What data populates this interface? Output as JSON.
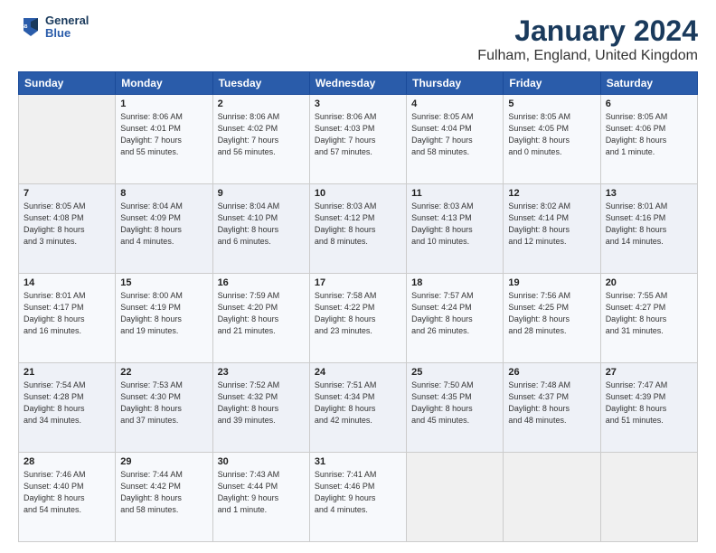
{
  "header": {
    "logo_text_1": "General",
    "logo_text_2": "Blue",
    "month": "January 2024",
    "location": "Fulham, England, United Kingdom"
  },
  "weekdays": [
    "Sunday",
    "Monday",
    "Tuesday",
    "Wednesday",
    "Thursday",
    "Friday",
    "Saturday"
  ],
  "weeks": [
    [
      {
        "day": "",
        "info": ""
      },
      {
        "day": "1",
        "info": "Sunrise: 8:06 AM\nSunset: 4:01 PM\nDaylight: 7 hours\nand 55 minutes."
      },
      {
        "day": "2",
        "info": "Sunrise: 8:06 AM\nSunset: 4:02 PM\nDaylight: 7 hours\nand 56 minutes."
      },
      {
        "day": "3",
        "info": "Sunrise: 8:06 AM\nSunset: 4:03 PM\nDaylight: 7 hours\nand 57 minutes."
      },
      {
        "day": "4",
        "info": "Sunrise: 8:05 AM\nSunset: 4:04 PM\nDaylight: 7 hours\nand 58 minutes."
      },
      {
        "day": "5",
        "info": "Sunrise: 8:05 AM\nSunset: 4:05 PM\nDaylight: 8 hours\nand 0 minutes."
      },
      {
        "day": "6",
        "info": "Sunrise: 8:05 AM\nSunset: 4:06 PM\nDaylight: 8 hours\nand 1 minute."
      }
    ],
    [
      {
        "day": "7",
        "info": "Sunrise: 8:05 AM\nSunset: 4:08 PM\nDaylight: 8 hours\nand 3 minutes."
      },
      {
        "day": "8",
        "info": "Sunrise: 8:04 AM\nSunset: 4:09 PM\nDaylight: 8 hours\nand 4 minutes."
      },
      {
        "day": "9",
        "info": "Sunrise: 8:04 AM\nSunset: 4:10 PM\nDaylight: 8 hours\nand 6 minutes."
      },
      {
        "day": "10",
        "info": "Sunrise: 8:03 AM\nSunset: 4:12 PM\nDaylight: 8 hours\nand 8 minutes."
      },
      {
        "day": "11",
        "info": "Sunrise: 8:03 AM\nSunset: 4:13 PM\nDaylight: 8 hours\nand 10 minutes."
      },
      {
        "day": "12",
        "info": "Sunrise: 8:02 AM\nSunset: 4:14 PM\nDaylight: 8 hours\nand 12 minutes."
      },
      {
        "day": "13",
        "info": "Sunrise: 8:01 AM\nSunset: 4:16 PM\nDaylight: 8 hours\nand 14 minutes."
      }
    ],
    [
      {
        "day": "14",
        "info": "Sunrise: 8:01 AM\nSunset: 4:17 PM\nDaylight: 8 hours\nand 16 minutes."
      },
      {
        "day": "15",
        "info": "Sunrise: 8:00 AM\nSunset: 4:19 PM\nDaylight: 8 hours\nand 19 minutes."
      },
      {
        "day": "16",
        "info": "Sunrise: 7:59 AM\nSunset: 4:20 PM\nDaylight: 8 hours\nand 21 minutes."
      },
      {
        "day": "17",
        "info": "Sunrise: 7:58 AM\nSunset: 4:22 PM\nDaylight: 8 hours\nand 23 minutes."
      },
      {
        "day": "18",
        "info": "Sunrise: 7:57 AM\nSunset: 4:24 PM\nDaylight: 8 hours\nand 26 minutes."
      },
      {
        "day": "19",
        "info": "Sunrise: 7:56 AM\nSunset: 4:25 PM\nDaylight: 8 hours\nand 28 minutes."
      },
      {
        "day": "20",
        "info": "Sunrise: 7:55 AM\nSunset: 4:27 PM\nDaylight: 8 hours\nand 31 minutes."
      }
    ],
    [
      {
        "day": "21",
        "info": "Sunrise: 7:54 AM\nSunset: 4:28 PM\nDaylight: 8 hours\nand 34 minutes."
      },
      {
        "day": "22",
        "info": "Sunrise: 7:53 AM\nSunset: 4:30 PM\nDaylight: 8 hours\nand 37 minutes."
      },
      {
        "day": "23",
        "info": "Sunrise: 7:52 AM\nSunset: 4:32 PM\nDaylight: 8 hours\nand 39 minutes."
      },
      {
        "day": "24",
        "info": "Sunrise: 7:51 AM\nSunset: 4:34 PM\nDaylight: 8 hours\nand 42 minutes."
      },
      {
        "day": "25",
        "info": "Sunrise: 7:50 AM\nSunset: 4:35 PM\nDaylight: 8 hours\nand 45 minutes."
      },
      {
        "day": "26",
        "info": "Sunrise: 7:48 AM\nSunset: 4:37 PM\nDaylight: 8 hours\nand 48 minutes."
      },
      {
        "day": "27",
        "info": "Sunrise: 7:47 AM\nSunset: 4:39 PM\nDaylight: 8 hours\nand 51 minutes."
      }
    ],
    [
      {
        "day": "28",
        "info": "Sunrise: 7:46 AM\nSunset: 4:40 PM\nDaylight: 8 hours\nand 54 minutes."
      },
      {
        "day": "29",
        "info": "Sunrise: 7:44 AM\nSunset: 4:42 PM\nDaylight: 8 hours\nand 58 minutes."
      },
      {
        "day": "30",
        "info": "Sunrise: 7:43 AM\nSunset: 4:44 PM\nDaylight: 9 hours\nand 1 minute."
      },
      {
        "day": "31",
        "info": "Sunrise: 7:41 AM\nSunset: 4:46 PM\nDaylight: 9 hours\nand 4 minutes."
      },
      {
        "day": "",
        "info": ""
      },
      {
        "day": "",
        "info": ""
      },
      {
        "day": "",
        "info": ""
      }
    ]
  ]
}
